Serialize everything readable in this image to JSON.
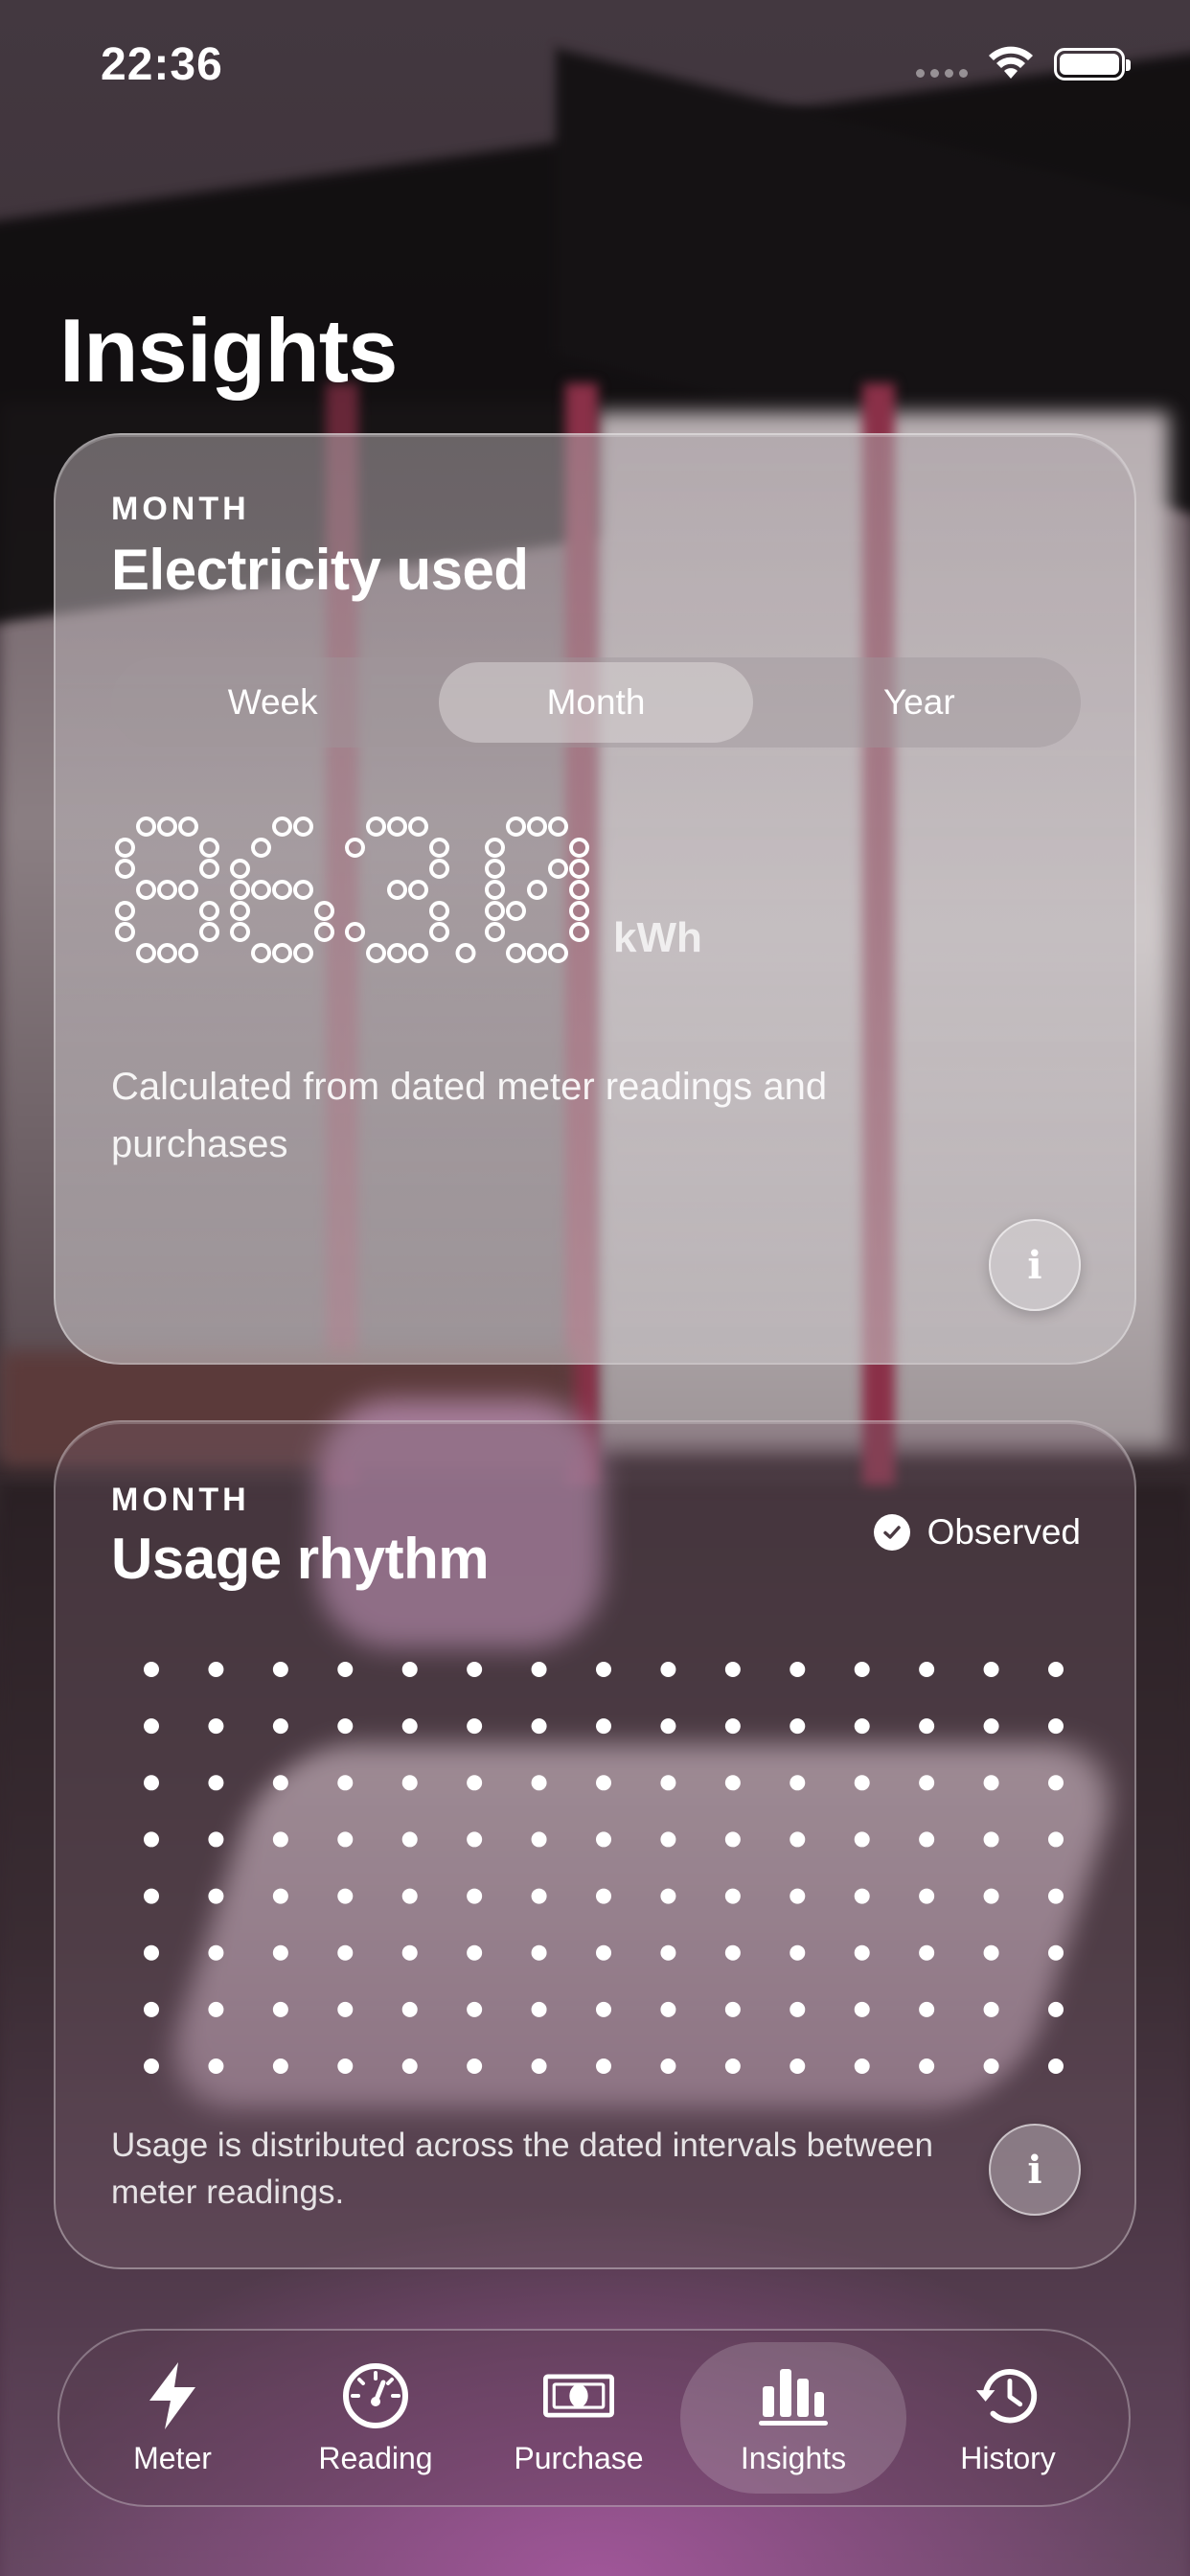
{
  "status_bar": {
    "time": "22:36"
  },
  "page": {
    "title": "Insights"
  },
  "electricity_card": {
    "eyebrow": "MONTH",
    "title": "Electricity used",
    "segments": [
      "Week",
      "Month",
      "Year"
    ],
    "selected_segment": "Month",
    "value": "863,0",
    "unit": "kWh",
    "description": "Calculated from dated meter readings and purchases",
    "info_icon": "info-icon"
  },
  "rhythm_card": {
    "eyebrow": "MONTH",
    "title": "Usage rhythm",
    "badge": "Observed",
    "badge_icon": "checkmark-circle-icon",
    "grid_rows": 8,
    "grid_columns": 15,
    "note": "Usage is distributed across the dated intervals between meter readings.",
    "info_icon": "info-icon"
  },
  "tab_bar": {
    "items": [
      {
        "label": "Meter",
        "icon": "bolt-icon"
      },
      {
        "label": "Reading",
        "icon": "gauge-icon"
      },
      {
        "label": "Purchase",
        "icon": "banknote-icon"
      },
      {
        "label": "Insights",
        "icon": "chart-bars-icon"
      },
      {
        "label": "History",
        "icon": "clock-history-icon"
      }
    ],
    "selected": "Insights"
  }
}
